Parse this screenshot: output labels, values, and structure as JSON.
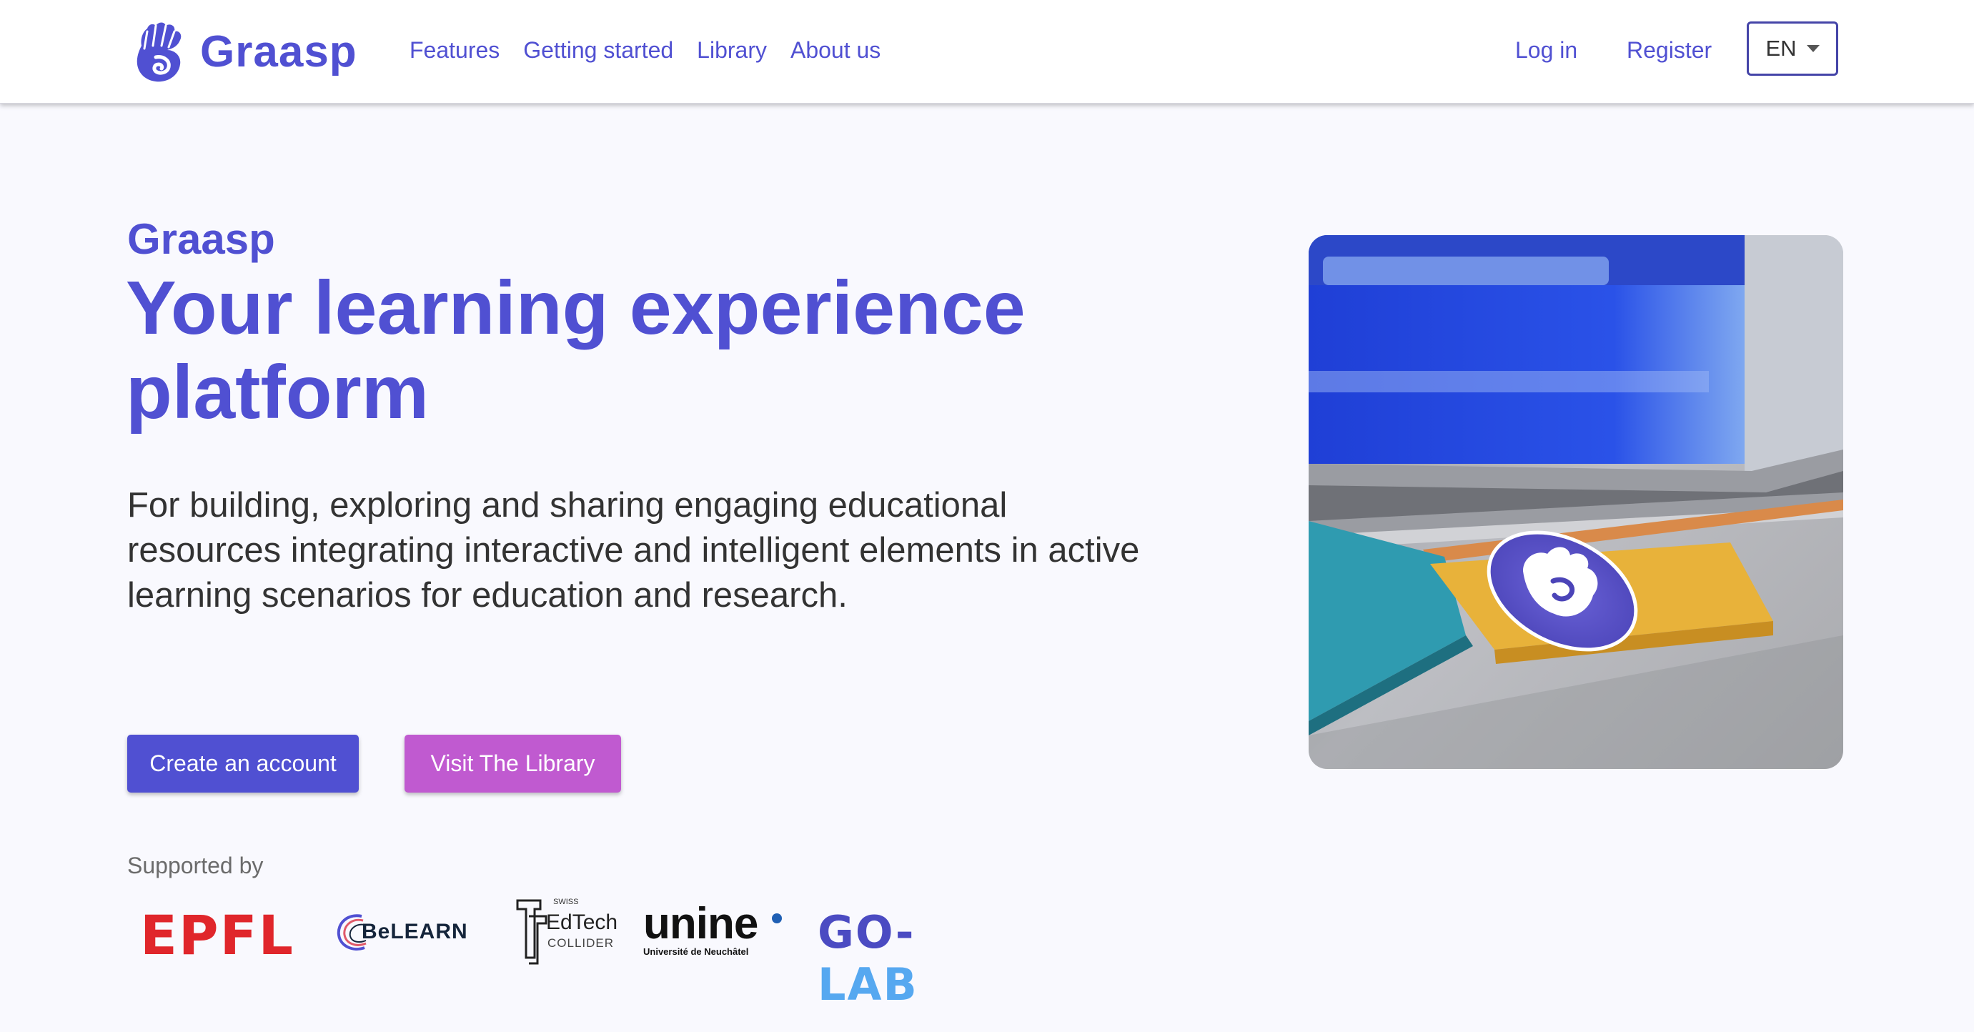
{
  "brand": {
    "name": "Graasp",
    "logo_icon": "graasp-hand-icon"
  },
  "nav": {
    "items": [
      {
        "label": "Features"
      },
      {
        "label": "Getting started"
      },
      {
        "label": "Library"
      },
      {
        "label": "About us"
      }
    ]
  },
  "auth": {
    "login": "Log in",
    "register": "Register"
  },
  "language": {
    "selected": "EN"
  },
  "hero": {
    "eyebrow": "Graasp",
    "headline": "Your learning experience platform",
    "lead": "For building, exploring and sharing engaging educational resources integrating interactive and intelligent elements in active learning scenarios for education and research.",
    "primary_button": "Create an account",
    "secondary_button": "Visit The Library",
    "supported_by": "Supported by"
  },
  "partners": {
    "epfl": "EPFL",
    "belearn": "BeLEARN",
    "edtech_small": "SWISS",
    "edtech_main": "EdTech",
    "edtech_sub": "COLLIDER",
    "unine": "unine",
    "unine_sub": "Université de Neuchâtel",
    "golab_go": "GO-",
    "golab_lab": "LAB"
  },
  "colors": {
    "brand": "#5050d2",
    "secondary": "#c05ad0",
    "background": "#f9f9fe",
    "epfl_red": "#e0262b",
    "golab_light": "#56a8f0"
  }
}
